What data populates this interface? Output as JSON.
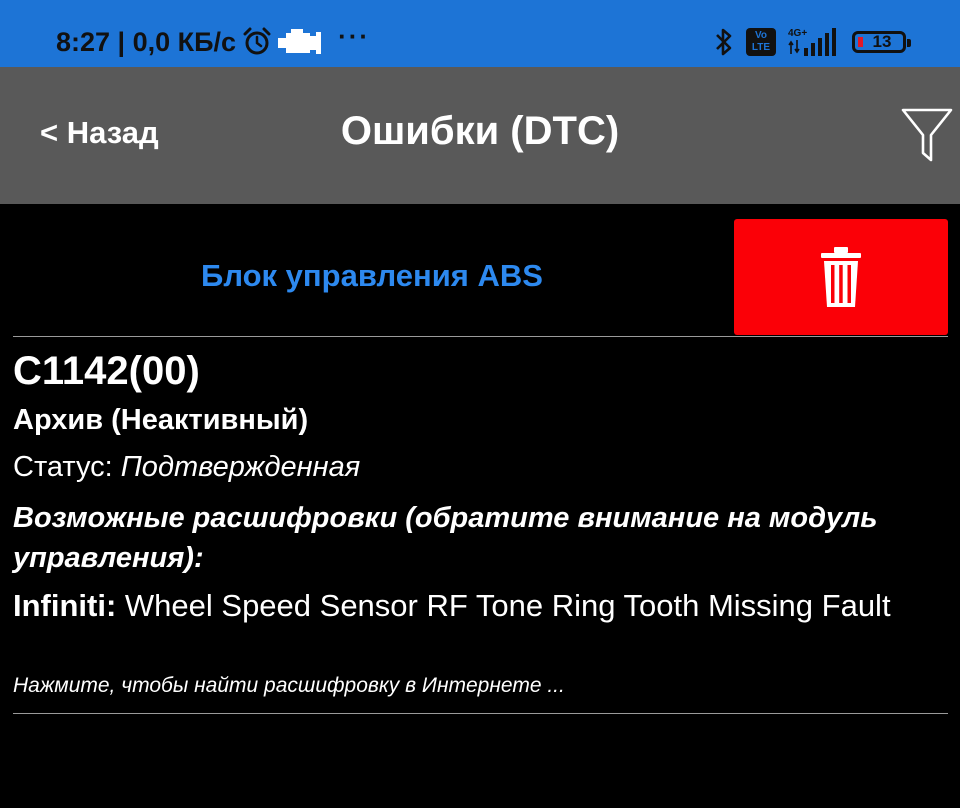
{
  "status_bar": {
    "time": "8:27",
    "separator": " | ",
    "network_speed": "0,0 КБ/с",
    "overflow_dots": "···",
    "volte_top": "Vo",
    "volte_bottom": "LTE",
    "network_type": "4G+",
    "battery_level": "13",
    "battery_color": "#e0192a",
    "icons": [
      "alarm-clock-icon",
      "check-engine-icon",
      "bluetooth-icon",
      "volte-icon",
      "signal-icon",
      "battery-icon"
    ]
  },
  "app_bar": {
    "back_label": "< Назад",
    "title": "Ошибки (DTC)",
    "filter_icon": "filter-funnel-icon",
    "background": "#595959"
  },
  "module": {
    "title": "Блок управления ABS",
    "title_color": "#2d89ef",
    "delete_icon": "trash-icon",
    "delete_color": "#fb0007"
  },
  "dtc": {
    "code": "C1142(00)",
    "archive": "Архив (Неактивный)",
    "status_label": "Статус: ",
    "status_value": "Подтвержденная",
    "possible_decodes": "Возможные расшифровки (обратите внимание на модуль управления):",
    "make": "Infiniti:",
    "description": " Wheel Speed Sensor RF Tone Ring Tooth Missing Fault",
    "search_hint": "Нажмите, чтобы найти расшифровку в Интернете ..."
  }
}
